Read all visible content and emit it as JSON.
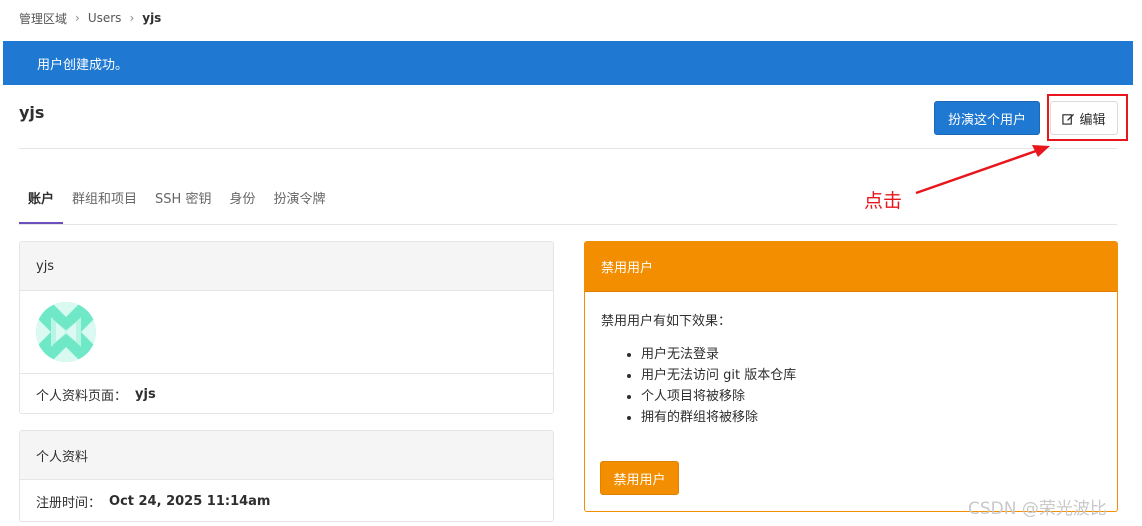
{
  "breadcrumb": {
    "items": [
      "管理区域",
      "Users"
    ],
    "current": "yjs"
  },
  "flash": {
    "message": "用户创建成功。"
  },
  "page": {
    "title": "yjs"
  },
  "actions": {
    "impersonate_label": "扮演这个用户",
    "edit_label": "编辑",
    "edit_icon": "pencil-square-icon"
  },
  "annotation": {
    "text": "点击",
    "color": "#e8161c"
  },
  "tabs": [
    {
      "label": "账户",
      "active": true
    },
    {
      "label": "群组和项目",
      "active": false
    },
    {
      "label": "SSH 密钥",
      "active": false
    },
    {
      "label": "身份",
      "active": false
    },
    {
      "label": "扮演令牌",
      "active": false
    }
  ],
  "user_card": {
    "header": "yjs",
    "profile_page_label": "个人资料页面：",
    "profile_page_value": "yjs"
  },
  "profile_card": {
    "header": "个人资料",
    "member_since_label": "注册时间：",
    "member_since_value": "Oct 24, 2025 11:14am"
  },
  "block_card": {
    "header": "禁用用户",
    "intro": "禁用用户有如下效果：",
    "effects": [
      "用户无法登录",
      "用户无法访问 git 版本仓库",
      "个人项目将被移除",
      "拥有的群组将被移除"
    ],
    "button_label": "禁用用户"
  },
  "watermark": "CSDN @荣光波比",
  "colors": {
    "primary": "#1f78d1",
    "warning": "#f28e00",
    "tab_active": "#6b4fbb",
    "annotation": "#e8161c"
  }
}
